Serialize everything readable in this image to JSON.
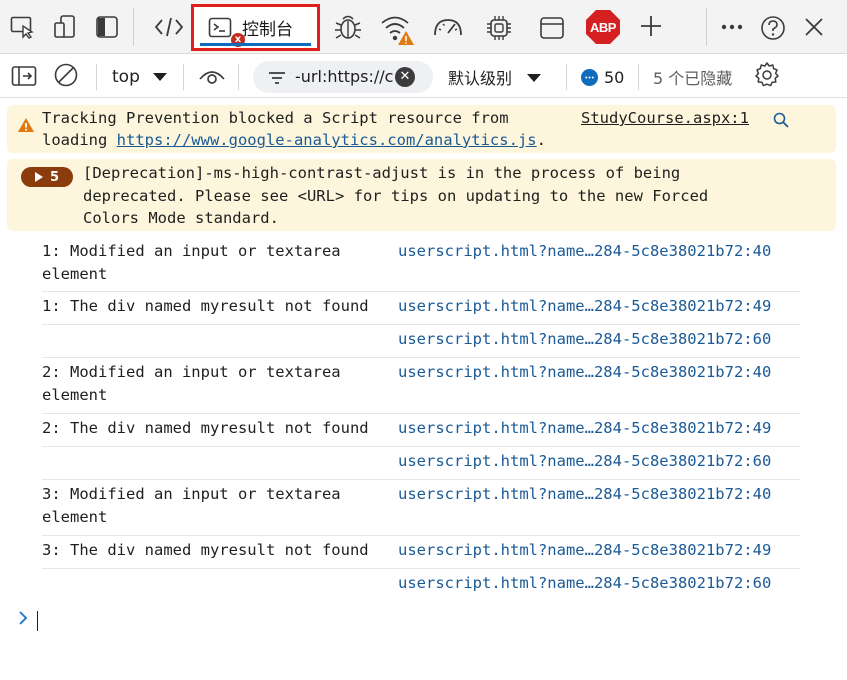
{
  "tabbar": {
    "console_label": "控制台",
    "error_badge": "x",
    "abp_label": "ABP",
    "icons": [
      "inspect-icon",
      "device-emulation-icon",
      "dock-side-icon",
      "elements-icon",
      "console-icon",
      "sources-icon",
      "network-icon",
      "performance-icon",
      "memory-icon",
      "application-icon",
      "adblock-icon",
      "add-tool-icon",
      "more-icon",
      "help-icon",
      "close-icon"
    ],
    "colors": {
      "active_outline": "#e0201b",
      "active_underline": "#0f6cbd",
      "error": "#c42b1c",
      "warning": "#e07a10",
      "abp": "#d42020"
    }
  },
  "toolbar": {
    "context": "top",
    "filter_value": "-url:https://c",
    "level": "默认级别",
    "message_count": "50",
    "hidden": "5 个已隐藏"
  },
  "console": {
    "tracking": {
      "line1": "Tracking Prevention blocked a Script resource from",
      "line2_prefix": "loading ",
      "url": "https://www.google-analytics.com/analytics.js",
      "line2_suffix": ".",
      "source": "StudyCourse.aspx:1"
    },
    "deprecation": {
      "count": "5",
      "line1": "[Deprecation]-ms-high-contrast-adjust is in the process of being",
      "line2": "deprecated. Please see <URL> for tips on updating to the new Forced",
      "line3": "Colors Mode standard."
    },
    "logs": [
      {
        "text": "1: Modified an input or textarea element",
        "source": "userscript.html?name…284-5c8e38021b72:40"
      },
      {
        "text": "1: The div named myresult not found",
        "source": "userscript.html?name…284-5c8e38021b72:49"
      },
      {
        "text": "",
        "source": "userscript.html?name…284-5c8e38021b72:60"
      },
      {
        "text": "2: Modified an input or textarea element",
        "source": "userscript.html?name…284-5c8e38021b72:40"
      },
      {
        "text": "2: The div named myresult not found",
        "source": "userscript.html?name…284-5c8e38021b72:49"
      },
      {
        "text": "",
        "source": "userscript.html?name…284-5c8e38021b72:60"
      },
      {
        "text": "3: Modified an input or textarea element",
        "source": "userscript.html?name…284-5c8e38021b72:40"
      },
      {
        "text": "3: The div named myresult not found",
        "source": "userscript.html?name…284-5c8e38021b72:49"
      },
      {
        "text": "",
        "source": "userscript.html?name…284-5c8e38021b72:60"
      }
    ]
  }
}
